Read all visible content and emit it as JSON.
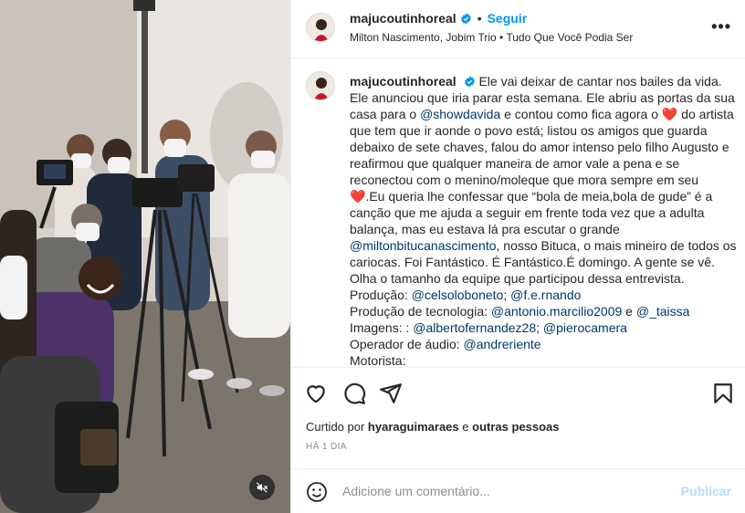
{
  "post": {
    "username": "majucoutinhoreal",
    "follow_label": "Seguir",
    "audio": "Milton Nascimento, Jobim Trio • Tudo Que Você Podia Ser",
    "more_label": "•••"
  },
  "caption": {
    "username": "majucoutinhoreal",
    "t1": " Ele vai deixar de cantar nos bailes da vida. Ele anunciou que iria parar esta semana. Ele abriu as portas da sua casa para o ",
    "m1": "@showdavida",
    "t2": " e contou como fica agora o ",
    "heart": "❤️",
    "t3": " do artista que tem que ir aonde o povo está; listou os amigos que guarda debaixo de sete chaves, falou do amor intenso pelo filho Augusto e reafirmou que qualquer maneira de amor vale a pena e se reconectou com o menino/moleque que mora sempre em seu ",
    "t4": ".Eu queria lhe confessar que “bola de meia,bola de gude” é a canção que me ajuda a seguir em frente toda vez que a adulta balança, mas eu estava lá pra escutar o grande ",
    "m2": "@miltonbitucanascimento",
    "t5": ", nosso Bituca, o mais mineiro de todos os cariocas. Foi Fantástico. É Fantástico.É domingo. A gente se vê. Olha o tamanho da equipe que participou dessa entrevista.",
    "prod_label": "Produção: ",
    "prod_m1": "@celsoloboneto",
    "prod_sep": "; ",
    "prod_m2": "@f.e.rnando",
    "tec_label": "Produção de tecnologia: ",
    "tec_m1": "@antonio.marcilio2009",
    "tec_sep": " e ",
    "tec_m2": "@_taissa",
    "img_label": "Imagens: : ",
    "img_m1": "@albertofernandez28",
    "img_sep": "; ",
    "img_m2": "@pierocamera",
    "audio_label": "Operador de áudio: ",
    "audio_m1": "@andreriente",
    "driver_label": "Motorista:"
  },
  "engagement": {
    "liked_prefix": "Curtido por ",
    "liked_user": "hyaraguimaraes",
    "liked_mid": " e ",
    "liked_others": "outras pessoas",
    "time": "HÁ 1 DIA"
  },
  "comment": {
    "placeholder": "Adicione um comentário...",
    "publish_label": "Publicar"
  },
  "icons": {
    "like": "heart-icon",
    "comment": "comment-icon",
    "share": "share-icon",
    "save": "bookmark-icon",
    "emoji": "emoji-icon",
    "mute": "muted-speaker-icon",
    "verified": "verified-badge-icon"
  },
  "colors": {
    "link": "#0095f6",
    "mention": "#00376b",
    "heart": "#ed4956",
    "publish_disabled": "#b2dffc"
  }
}
